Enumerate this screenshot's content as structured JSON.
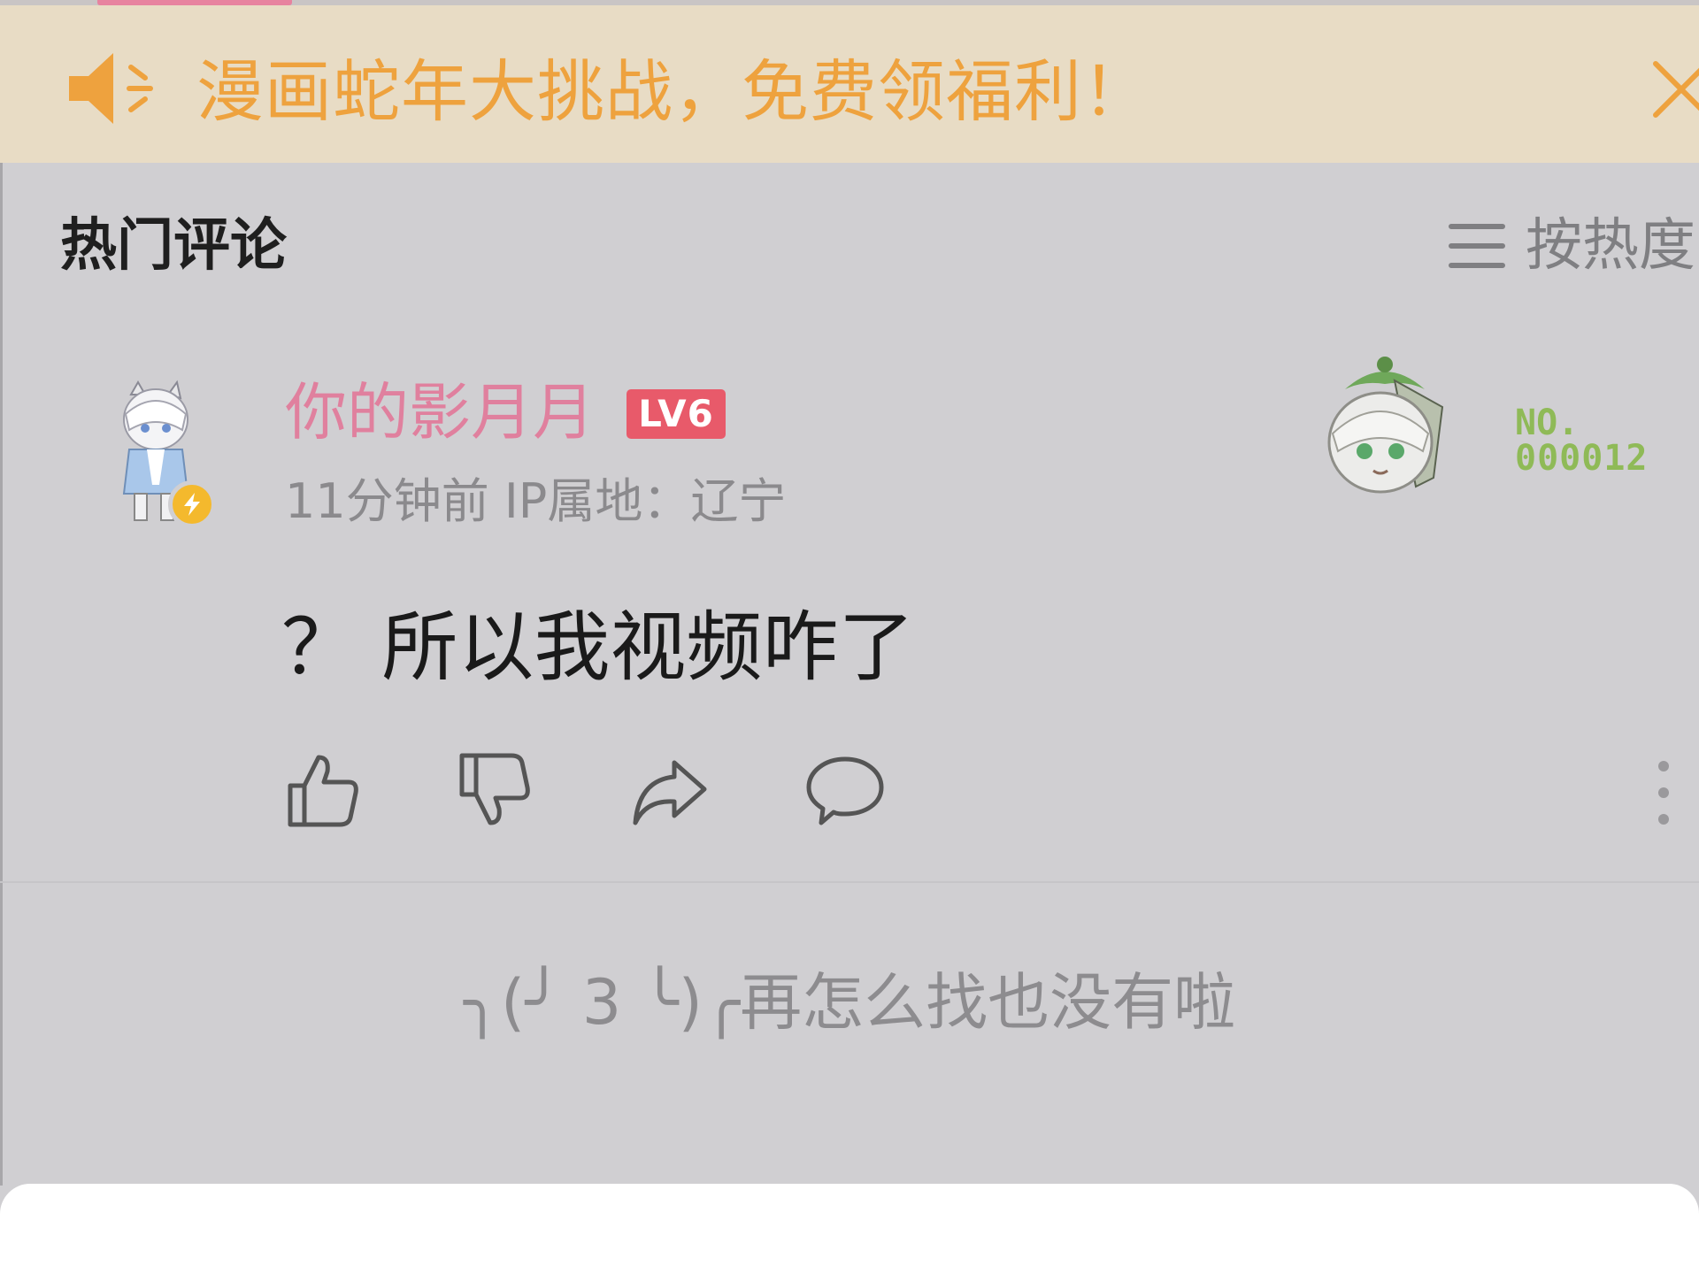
{
  "banner": {
    "text": "漫画蛇年大挑战，免费领福利！",
    "speaker_icon": "speaker-icon",
    "close_icon": "close-icon",
    "accent_color": "#eea23e"
  },
  "comments_section": {
    "title": "热门评论",
    "sort_label": "按热度",
    "sort_icon": "menu-lines-icon"
  },
  "comment": {
    "username": "你的影月月",
    "level": "LV6",
    "meta": "11分钟前 IP属地：辽宁",
    "content": "？ 所以我视频咋了",
    "fan_badge_line1": "NO.",
    "fan_badge_line2": "000012",
    "username_color": "#e0809e",
    "actions": [
      "like-icon",
      "dislike-icon",
      "share-icon",
      "reply-icon",
      "more-icon"
    ]
  },
  "end_of_list": {
    "text": "╮(╯ 3 ╰)╭再怎么找也没有啦"
  }
}
